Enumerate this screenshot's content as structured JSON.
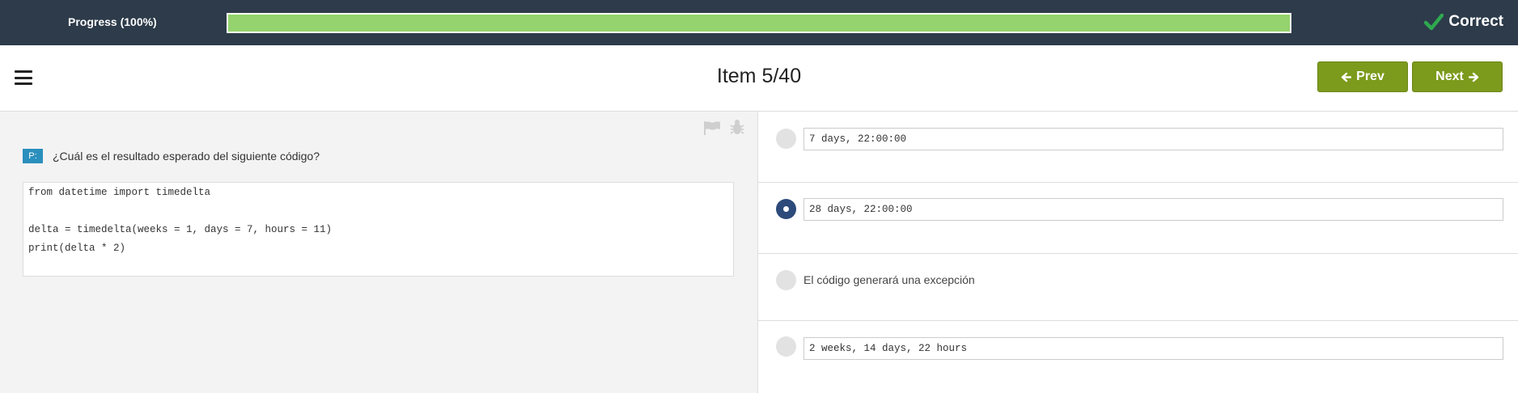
{
  "progress": {
    "label": "Progress (100%)",
    "percent": 100,
    "fill_color": "#94d36d",
    "status_label": "Correct",
    "status_icon": "check-icon"
  },
  "header": {
    "menu_icon": "hamburger-menu-icon",
    "title": "Item 5/40",
    "prev_label": "Prev",
    "next_label": "Next",
    "button_color": "#7c9a1c"
  },
  "question": {
    "badge": "P:",
    "text": "¿Cuál es el resultado esperado del siguiente código?",
    "code_lines": [
      "from datetime import timedelta",
      "",
      "delta = timedelta(weeks = 1, days = 7, hours = 11)",
      "print(delta * 2)"
    ],
    "toolbar_icons": [
      "flag-icon",
      "bug-icon"
    ]
  },
  "options": [
    {
      "text": "7 days, 22:00:00",
      "style": "code",
      "selected": false
    },
    {
      "text": "28 days, 22:00:00",
      "style": "code",
      "selected": true
    },
    {
      "text": "El código generará una excepción",
      "style": "plain",
      "selected": false
    },
    {
      "text": "2 weeks, 14 days, 22 hours",
      "style": "code",
      "selected": false
    }
  ]
}
